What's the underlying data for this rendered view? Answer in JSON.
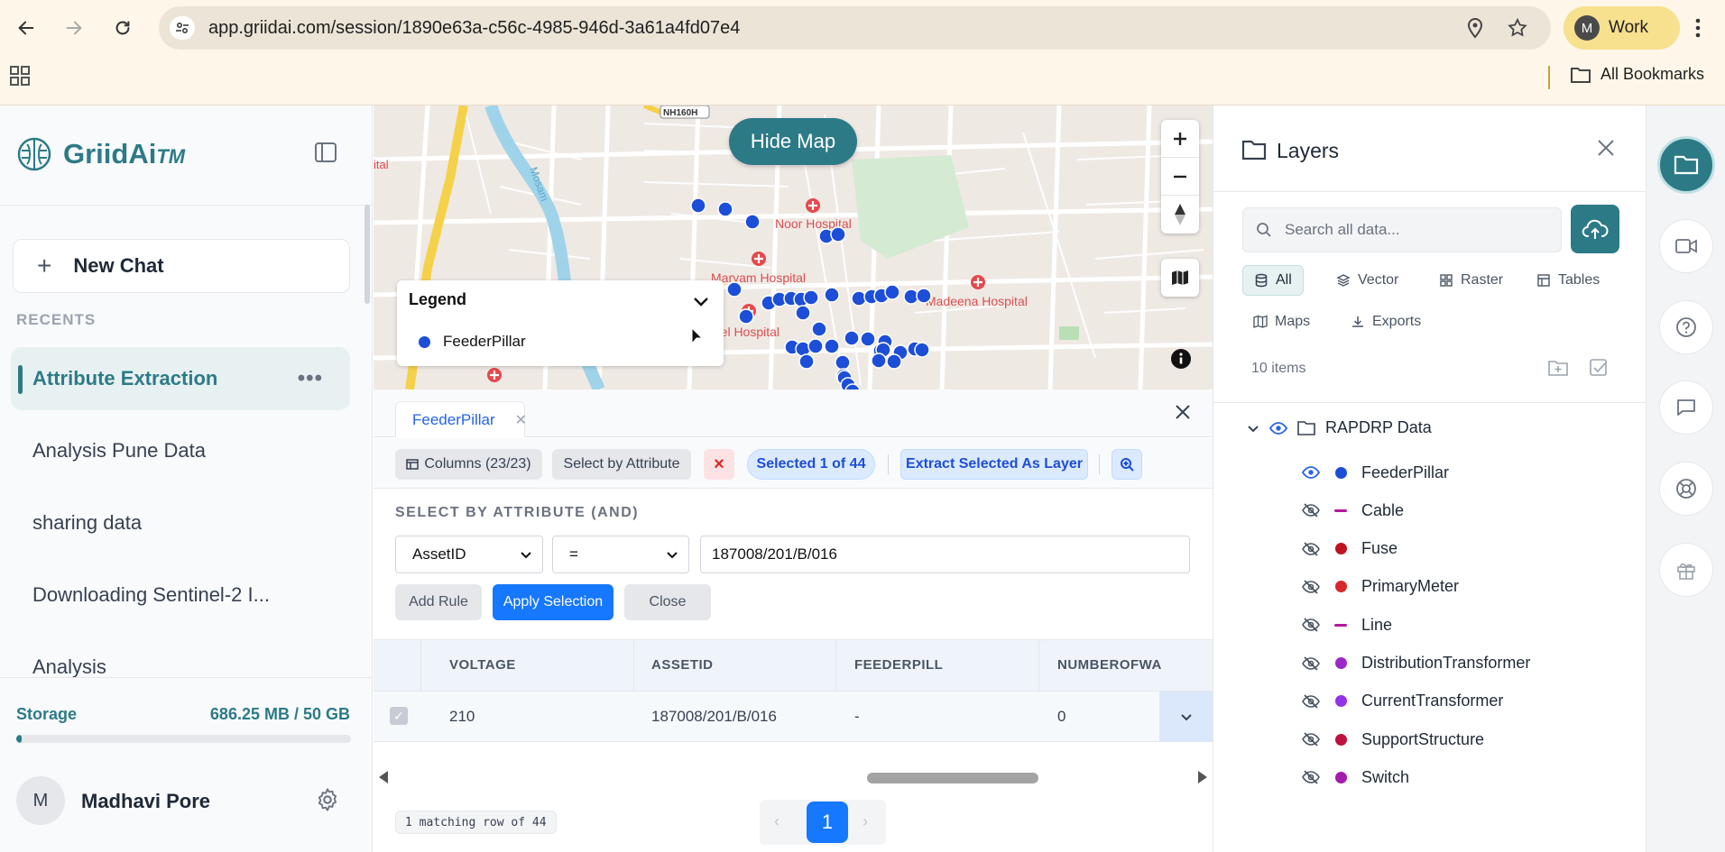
{
  "browser": {
    "url": "app.griidai.com/session/1890e63a-c56c-4985-946d-3a61a4fd07e4",
    "profile_initial": "M",
    "profile_label": "Work",
    "bookmarks_label": "All Bookmarks"
  },
  "sidebar": {
    "logo_text": "GriidAi",
    "logo_tm": "TM",
    "new_chat_label": "New Chat",
    "recents_label": "RECENTS",
    "chats": [
      {
        "label": "Attribute Extraction",
        "active": true
      },
      {
        "label": "Analysis Pune Data",
        "active": false
      },
      {
        "label": "sharing data",
        "active": false
      },
      {
        "label": "Downloading Sentinel-2 I...",
        "active": false
      },
      {
        "label": "Analysis",
        "active": false
      }
    ],
    "storage_label": "Storage",
    "storage_value": "686.25 MB / 50 GB",
    "storage_fraction": 0.0137,
    "user_initial": "M",
    "user_name": "Madhavi Pore"
  },
  "map": {
    "hide_map_label": "Hide Map",
    "legend_title": "Legend",
    "legend_item": "FeederPillar",
    "labels": {
      "noor": "Noor Hospital",
      "maryam": "Maryam Hospital",
      "madeena": "Madeena Hospital",
      "parcel": "rcel Hospital",
      "road": "NH160H",
      "river": "Mosam",
      "edge": "ital"
    },
    "feeder_color": "#1d4ed8"
  },
  "data_panel": {
    "tab_label": "FeederPillar",
    "toolbar": {
      "columns_label": "Columns (23/23)",
      "select_by_attr_label": "Select by Attribute",
      "clear_label": "×",
      "selected_label": "Selected 1 of 44",
      "extract_label": "Extract Selected As Layer"
    },
    "sba_title": "SELECT BY ATTRIBUTE (AND)",
    "rule": {
      "field": "AssetID",
      "operator": "=",
      "value": "187008/201/B/016"
    },
    "add_rule_label": "Add Rule",
    "apply_label": "Apply Selection",
    "close_label": "Close",
    "table": {
      "headers": [
        "VOLTAGE",
        "ASSETID",
        "FEEDERPILL",
        "NUMBEROFWA"
      ],
      "rows": [
        [
          "210",
          "187008/201/B/016",
          "-",
          "0"
        ]
      ]
    },
    "footer_count": "1 matching row of 44",
    "page": "1",
    "prev": "‹",
    "next": "›"
  },
  "layers": {
    "title": "Layers",
    "search_placeholder": "Search all data...",
    "filters": [
      "All",
      "Vector",
      "Raster",
      "Tables",
      "Maps",
      "Exports"
    ],
    "items_count": "10 items",
    "group_name": "RAPDRP Data",
    "items": [
      {
        "name": "FeederPillar",
        "visible": true,
        "kind": "dot",
        "color": "#1d4ed8"
      },
      {
        "name": "Cable",
        "visible": false,
        "kind": "line",
        "color": "#b5179e"
      },
      {
        "name": "Fuse",
        "visible": false,
        "kind": "dot",
        "color": "#c1121f"
      },
      {
        "name": "PrimaryMeter",
        "visible": false,
        "kind": "dot",
        "color": "#d62828"
      },
      {
        "name": "Line",
        "visible": false,
        "kind": "line",
        "color": "#b5179e"
      },
      {
        "name": "DistributionTransformer",
        "visible": false,
        "kind": "dot",
        "color": "#9d28c9"
      },
      {
        "name": "CurrentTransformer",
        "visible": false,
        "kind": "dot",
        "color": "#9333ea"
      },
      {
        "name": "SupportStructure",
        "visible": false,
        "kind": "dot",
        "color": "#be123c"
      },
      {
        "name": "Switch",
        "visible": false,
        "kind": "dot",
        "color": "#a21caf"
      }
    ]
  }
}
